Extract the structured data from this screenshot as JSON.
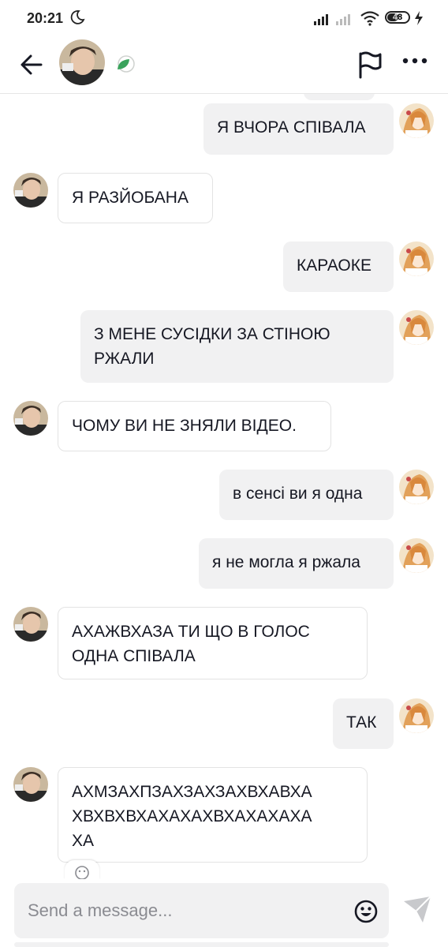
{
  "status_bar": {
    "time": "20:21",
    "battery": "48"
  },
  "colors": {
    "incoming_bg": "#ffffff",
    "outgoing_bg": "#f1f1f2",
    "send_icon": "#c8c9cc",
    "leaf_badge": "#3aa35c"
  },
  "header": {
    "back_icon": "arrow-left-icon",
    "badge_icon": "leaf-badge-icon",
    "report_icon": "flag-icon",
    "more_icon": "more-horizontal-icon"
  },
  "messages": [
    {
      "side": "out",
      "text": "Я ВЧОРА СПІВАЛА"
    },
    {
      "side": "in",
      "text": "Я РАЗЙОБАНА"
    },
    {
      "side": "out",
      "text": "КАРАОКЕ"
    },
    {
      "side": "out",
      "text": "З МЕНЕ СУСІДКИ ЗА СТІНОЮ\nРЖАЛИ"
    },
    {
      "side": "in",
      "text": "ЧОМУ ВИ НЕ ЗНЯЛИ ВІДЕО."
    },
    {
      "side": "out",
      "text": "в сенсі ви я одна"
    },
    {
      "side": "out",
      "text": "я не могла я ржала"
    },
    {
      "side": "in",
      "text": "АХАЖВХАЗА ТИ ЩО В ГОЛОС\nОДНА СПІВАЛА"
    },
    {
      "side": "out",
      "text": "ТАК"
    },
    {
      "side": "in",
      "text": "АХМЗАХПЗАХЗАХЗАХВХАВХА\nХВХВХВХАХАХАХВХАХАХАХА\nХА"
    }
  ],
  "composer": {
    "placeholder": "Send a message...",
    "emoji_icon": "emoji-icon",
    "send_icon": "send-icon"
  }
}
